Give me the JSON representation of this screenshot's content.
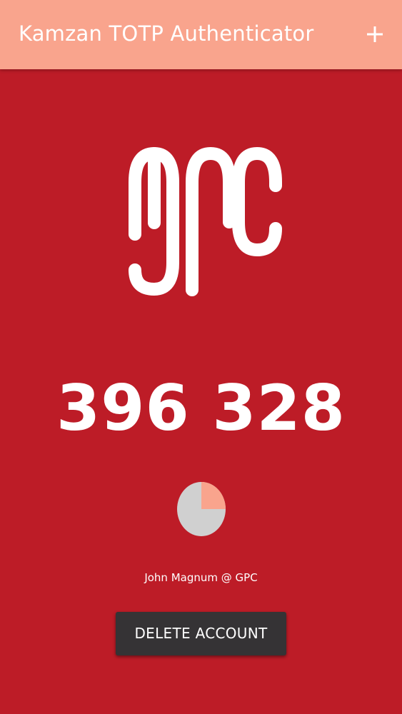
{
  "app": {
    "title": "Kamzan TOTP Authenticator"
  },
  "toolbar": {
    "add_icon": "plus-icon"
  },
  "logo": {
    "icon": "gpc-logo"
  },
  "otp": {
    "code": "396 328"
  },
  "timer": {
    "elapsed_fraction": 0.25,
    "colors": {
      "remaining": "#d0d0d0",
      "elapsed": "#f9a48d"
    }
  },
  "account": {
    "label": "John Magnum @ GPC"
  },
  "actions": {
    "delete_label": "DELETE ACCOUNT"
  },
  "colors": {
    "background": "#bd1c27",
    "appbar": "#f9a48d",
    "button": "#353335",
    "text": "#ffffff"
  }
}
